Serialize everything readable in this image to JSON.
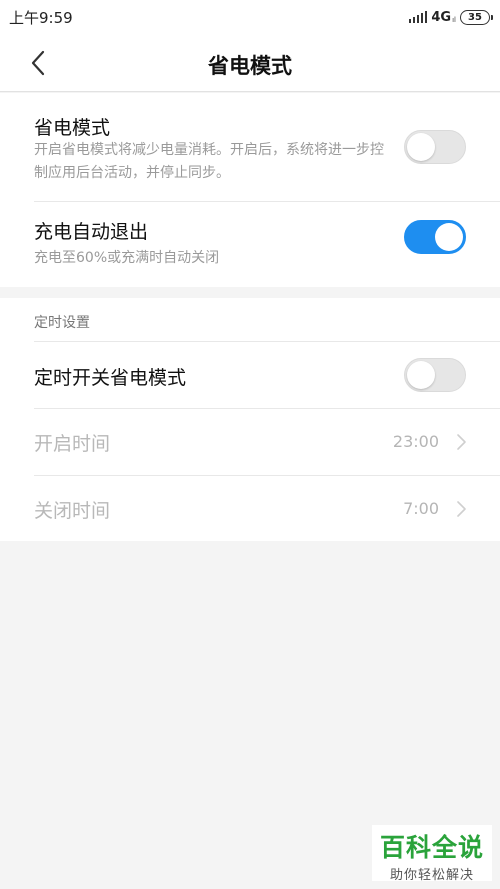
{
  "status_bar": {
    "time": "上午9:59",
    "network": "4G",
    "network_sub": "ıl",
    "battery": "35"
  },
  "header": {
    "title": "省电模式",
    "back_icon": "chevron-left-icon"
  },
  "settings": {
    "power_saving": {
      "title": "省电模式",
      "subtitle": "开启省电模式将减少电量消耗。开启后，系统将进一步控制应用后台活动，并停止同步。",
      "enabled": false
    },
    "auto_exit": {
      "title": "充电自动退出",
      "subtitle": "充电至60%或充满时自动关闭",
      "enabled": true
    }
  },
  "schedule": {
    "section_title": "定时设置",
    "timer_toggle": {
      "title": "定时开关省电模式",
      "enabled": false
    },
    "start_time": {
      "label": "开启时间",
      "value": "23:00"
    },
    "end_time": {
      "label": "关闭时间",
      "value": "7:00"
    }
  },
  "watermark": {
    "main": "百科全说",
    "sub": "助你轻松解决"
  },
  "colors": {
    "accent": "#1e8ef0",
    "watermark_green": "#2aa33b"
  }
}
